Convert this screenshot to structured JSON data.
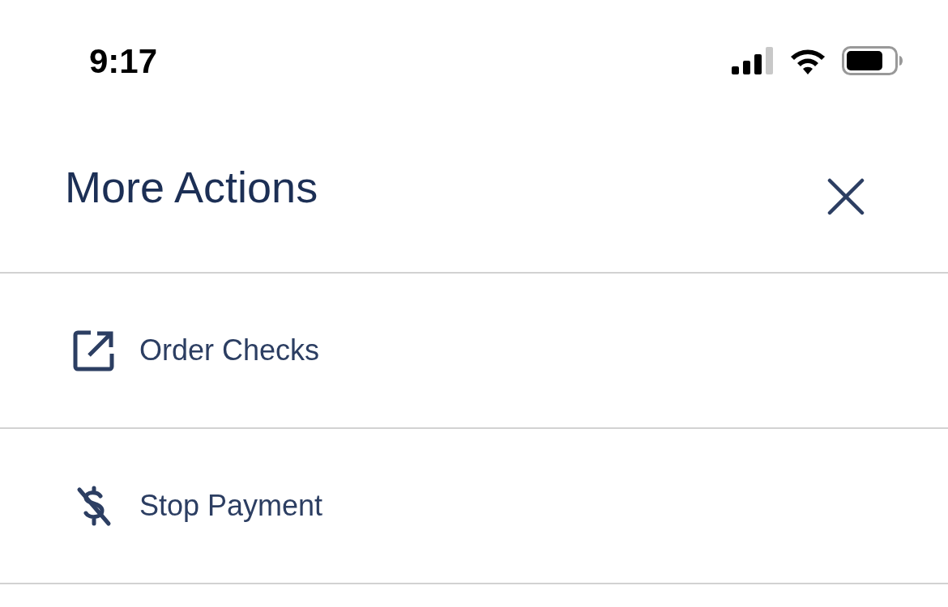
{
  "status_bar": {
    "time": "9:17"
  },
  "header": {
    "title": "More Actions"
  },
  "actions": [
    {
      "label": "Order Checks",
      "kind": "external"
    },
    {
      "label": "Stop Payment",
      "kind": "no-dollar"
    }
  ]
}
